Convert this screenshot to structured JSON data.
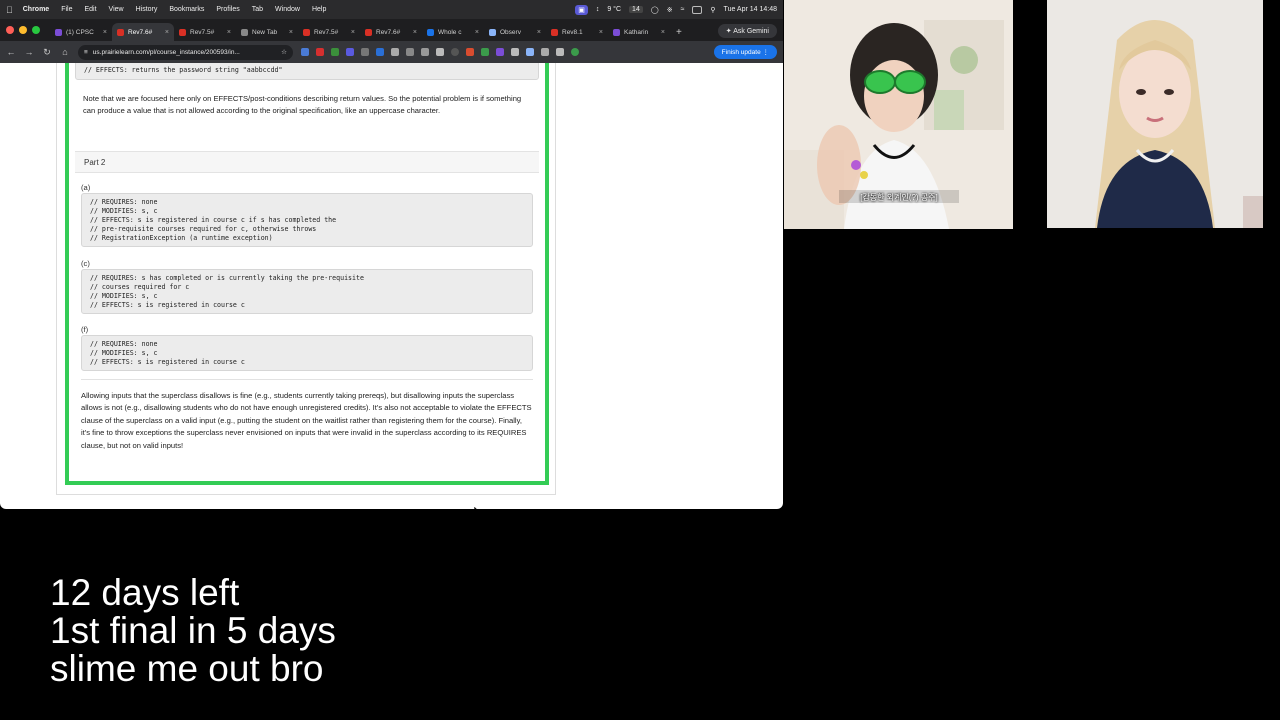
{
  "menubar": {
    "app": "Chrome",
    "items": [
      "File",
      "Edit",
      "View",
      "History",
      "Bookmarks",
      "Profiles",
      "Tab",
      "Window",
      "Help"
    ],
    "temperature": "9 °C",
    "badge_num": "14",
    "datetime": "Tue Apr 14  14:48"
  },
  "tabs": [
    {
      "title": "(1) CPSC",
      "color": "#7b4dd6",
      "active": false
    },
    {
      "title": "Rev7.6#",
      "color": "#d93025",
      "active": true
    },
    {
      "title": "Rev7.5#",
      "color": "#d93025",
      "active": false
    },
    {
      "title": "New Tab",
      "color": "#888888",
      "active": false
    },
    {
      "title": "Rev7.5#",
      "color": "#d93025",
      "active": false
    },
    {
      "title": "Rev7.6#",
      "color": "#d93025",
      "active": false
    },
    {
      "title": "Whole c",
      "color": "#1a73e8",
      "active": false
    },
    {
      "title": "Observ",
      "color": "#8ab4f8",
      "active": false
    },
    {
      "title": "Rev8.1",
      "color": "#d93025",
      "active": false
    },
    {
      "title": "Katharin",
      "color": "#7b4dd6",
      "active": false
    }
  ],
  "gemini_label": "Ask Gemini",
  "toolbar": {
    "url": "us.prairielearn.com/pl/course_instance/200593/in...",
    "finish_label": "Finish update"
  },
  "page": {
    "top_code": "// EFFECTS: returns the password string \"aabbccdd\"",
    "note": "Note that we are focused here only on EFFECTS/post-conditions describing return values. So the potential problem is if something can produce a value that is not allowed according to the original specification, like an uppercase character.",
    "part2_title": "Part 2",
    "options": [
      {
        "label": "(a)",
        "code": "// REQUIRES: none\n// MODIFIES: s, c\n// EFFECTS: s is registered in course c if s has completed the\n// pre-requisite courses required for c, otherwise throws\n// RegistrationException (a runtime exception)"
      },
      {
        "label": "(c)",
        "code": "// REQUIRES: s has completed or is currently taking the pre-requisite\n// courses required for c\n// MODIFIES: s, c\n// EFFECTS: s is registered in course c"
      },
      {
        "label": "(f)",
        "code": "// REQUIRES: none\n// MODIFIES: s, c\n// EFFECTS: s is registered in course c"
      }
    ],
    "explanation": "Allowing inputs that the superclass disallows is fine (e.g., students currently taking prereqs), but disallowing inputs the superclass allows is not (e.g., disallowing students who do not have enough unregistered credits). It's also not acceptable to violate the EFFECTS clause of the superclass on a valid input (e.g., putting the student on the waitlist rather than registering them for the course). Finally, it's fine to throw exceptions the superclass never envisioned on inputs that were invalid in the superclass according to its REQUIRES clause, but not on valid inputs!"
  },
  "webcam": {
    "caption": "[감동한 외계인(?) 공주]"
  },
  "overlay": {
    "line1": "12 days left",
    "line2": "1st final in 5 days",
    "line3": "slime me out bro"
  }
}
